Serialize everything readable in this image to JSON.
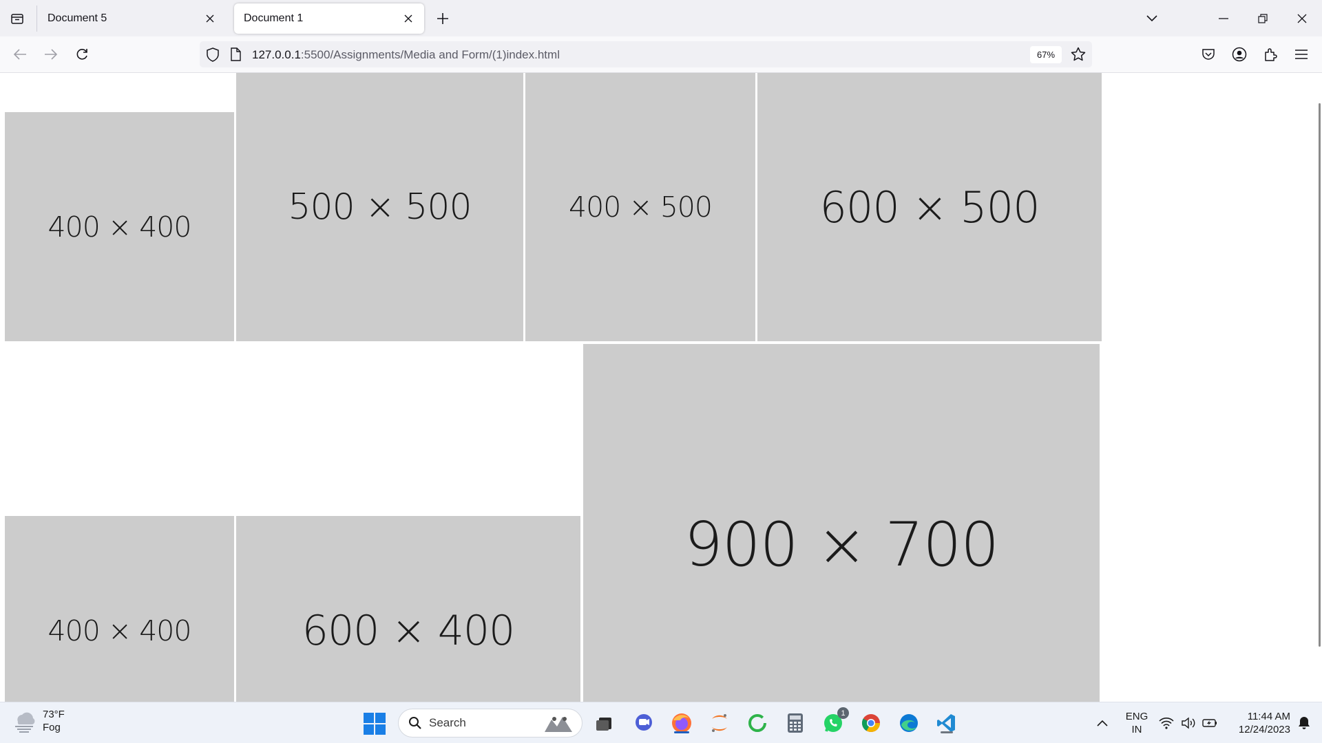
{
  "tabs": [
    {
      "label": "Document 5",
      "active": false
    },
    {
      "label": "Document 1",
      "active": true
    }
  ],
  "urlbar": {
    "host": "127.0.0.1",
    "path": ":5500/Assignments/Media and Form/(1)index.html",
    "zoom": "67%"
  },
  "placeholders": [
    {
      "label": "400 × 400"
    },
    {
      "label": "500 × 500"
    },
    {
      "label": "400 × 500"
    },
    {
      "label": "600 × 500"
    },
    {
      "label": "400 × 400"
    },
    {
      "label": "600 × 400"
    },
    {
      "label": "900 × 700"
    }
  ],
  "taskbar": {
    "weather_temp": "73°F",
    "weather_desc": "Fog",
    "search_label": "Search",
    "whatsapp_badge": "1",
    "lang_line1": "ENG",
    "lang_line2": "IN",
    "time": "11:44 AM",
    "date": "12/24/2023"
  },
  "colors": {
    "placeholder_bg": "#cccccc",
    "tabbar_bg": "#f0f0f4",
    "taskbar_bg": "#eef2f9",
    "accent": "#0060df"
  }
}
